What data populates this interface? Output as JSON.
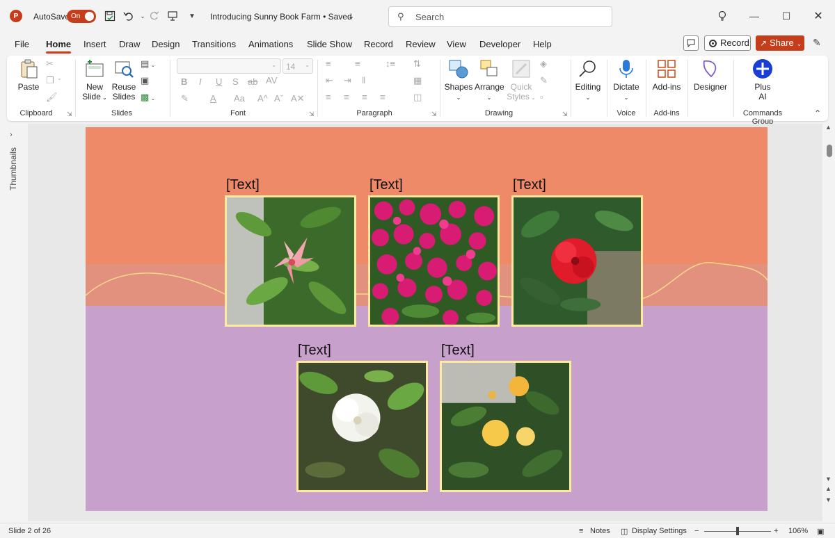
{
  "titlebar": {
    "autosave_label": "AutoSave",
    "autosave_state": "On",
    "doc_title": "Introducing Sunny Book Farm • Saved",
    "search_placeholder": "Search",
    "app_letter": "P"
  },
  "menu": {
    "tabs": [
      "File",
      "Home",
      "Insert",
      "Draw",
      "Design",
      "Transitions",
      "Animations",
      "Slide Show",
      "Record",
      "Review",
      "View",
      "Developer",
      "Help"
    ],
    "active": "Home",
    "record_label": "Record",
    "share_label": "Share"
  },
  "ribbon": {
    "clipboard": {
      "paste": "Paste",
      "group": "Clipboard"
    },
    "slides": {
      "new_slide_1": "New",
      "new_slide_2": "Slide",
      "reuse_1": "Reuse",
      "reuse_2": "Slides",
      "group": "Slides"
    },
    "font": {
      "size": "14",
      "group": "Font"
    },
    "paragraph": {
      "group": "Paragraph"
    },
    "drawing": {
      "shapes": "Shapes",
      "arrange": "Arrange",
      "quick_1": "Quick",
      "quick_2": "Styles",
      "group": "Drawing"
    },
    "editing": {
      "label": "Editing"
    },
    "voice": {
      "dictate": "Dictate",
      "group": "Voice"
    },
    "addins": {
      "label": "Add-ins",
      "group": "Add-ins"
    },
    "designer": {
      "label": "Designer"
    },
    "commands": {
      "plus_1": "Plus",
      "plus_2": "AI",
      "group": "Commands Group"
    }
  },
  "thumbnails_label": "Thumbnails",
  "slide": {
    "colors": {
      "top": "#ef8a68",
      "mid": "#e3917f",
      "bottom": "#c8a0cc",
      "frame": "#fbeaa0",
      "wave": "#f6d889"
    },
    "photos": [
      {
        "label": "[Text]",
        "subject": "pink-lily"
      },
      {
        "label": "[Text]",
        "subject": "magenta-bougainvillea"
      },
      {
        "label": "[Text]",
        "subject": "red-hibiscus"
      },
      {
        "label": "[Text]",
        "subject": "white-gardenia"
      },
      {
        "label": "[Text]",
        "subject": "yellow-ixora"
      }
    ]
  },
  "status": {
    "slide_info": "Slide 2 of 26",
    "notes": "Notes",
    "display_settings": "Display Settings",
    "zoom": "106%"
  },
  "accent": "#c43e1c"
}
